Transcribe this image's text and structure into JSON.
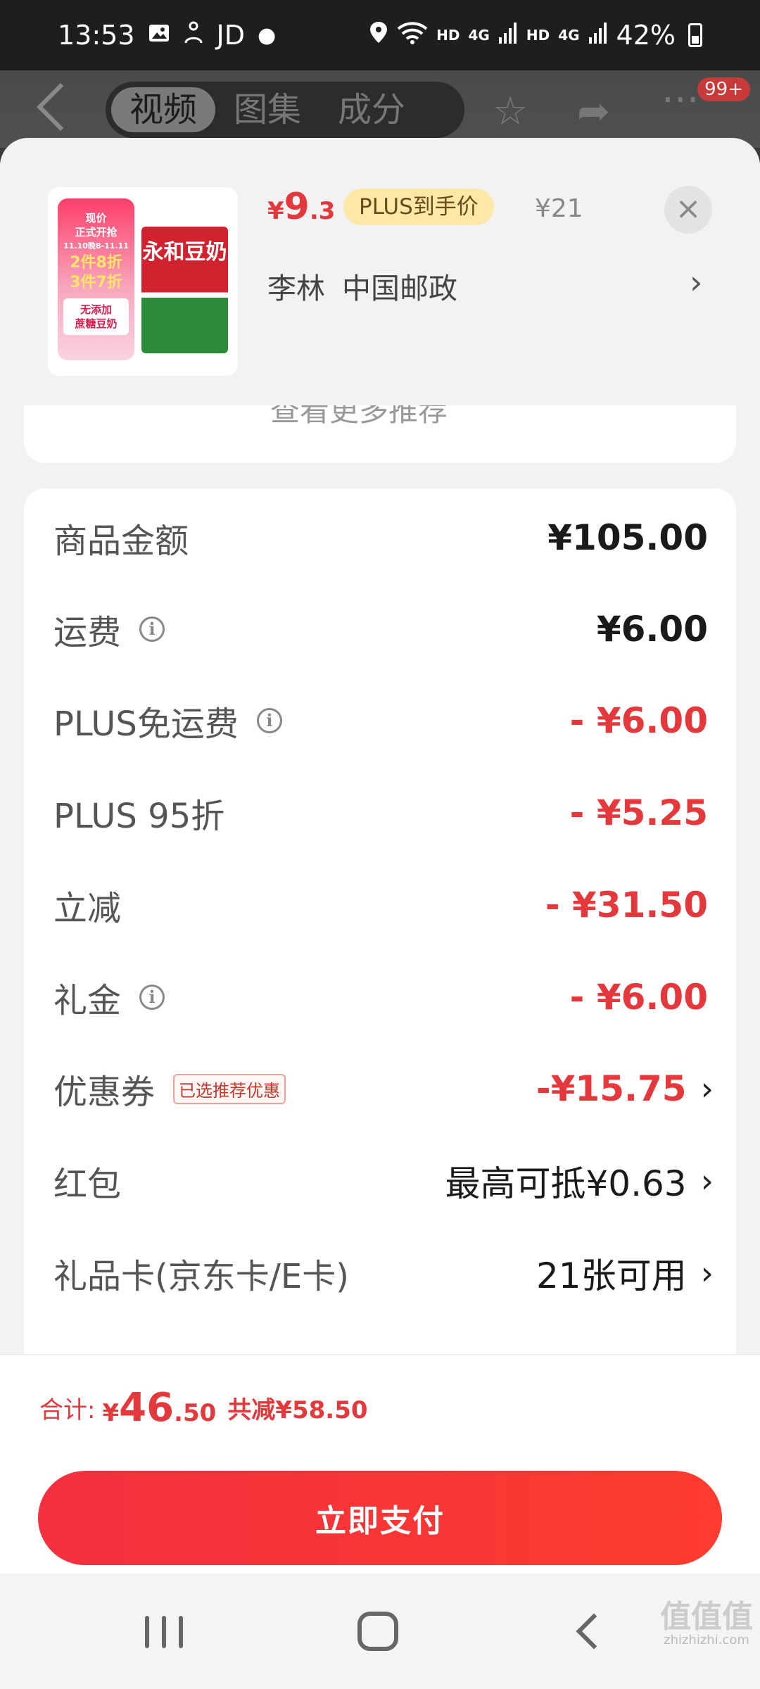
{
  "status_bar": {
    "time": "13:53",
    "app_label": "JD",
    "net1": "HD",
    "net2": "4G",
    "net3": "HD",
    "net4": "4G",
    "battery": "42%"
  },
  "header": {
    "tabs": [
      "视频",
      "图集",
      "成分"
    ],
    "active_tab_index": 0,
    "badge": "99+"
  },
  "product": {
    "promo_lines": [
      "现价",
      "正式开抢",
      "11.10晚8-11.11",
      "2件8折",
      "3件7折",
      "无添加",
      "蔗糖豆奶"
    ],
    "bag_text": "永和豆奶",
    "price_currency": "¥",
    "price_int": "9",
    "price_dec": ".3",
    "plus_tag": "PLUS到手价",
    "original_price": "¥21",
    "recipient": "李林",
    "address": "中国邮政",
    "more_recommend": "查看更多推荐"
  },
  "summary": {
    "rows": [
      {
        "label": "商品金额",
        "value": "¥105.00",
        "style": "black",
        "info": false
      },
      {
        "label": "运费",
        "value": "¥6.00",
        "style": "black",
        "info": true
      },
      {
        "label": "PLUS免运费",
        "value": "- ¥6.00",
        "style": "red",
        "info": true
      },
      {
        "label": "PLUS 95折",
        "value": "- ¥5.25",
        "style": "red",
        "info": false
      },
      {
        "label": "立减",
        "value": "- ¥31.50",
        "style": "red",
        "info": false
      },
      {
        "label": "礼金",
        "value": "- ¥6.00",
        "style": "red",
        "info": true
      },
      {
        "label": "优惠券",
        "value": "-¥15.75",
        "style": "red",
        "badge": "已选推荐优惠",
        "chevron": true
      },
      {
        "label": "红包",
        "value": "最高可抵¥0.63",
        "style": "plain",
        "chevron": true
      },
      {
        "label": "礼品卡(京东卡/E卡)",
        "value": "21张可用",
        "style": "plain",
        "chevron": true
      }
    ]
  },
  "total": {
    "label": "合计:",
    "currency": "¥",
    "int": "46",
    "dec": ".50",
    "saved": "共减¥58.50"
  },
  "pay_button": "立即支付",
  "watermark": {
    "text": "值值值",
    "url": "zhizhizhi.com"
  },
  "colors": {
    "accent": "#e4393c",
    "plus_tag_bg": "#fde8a8"
  }
}
